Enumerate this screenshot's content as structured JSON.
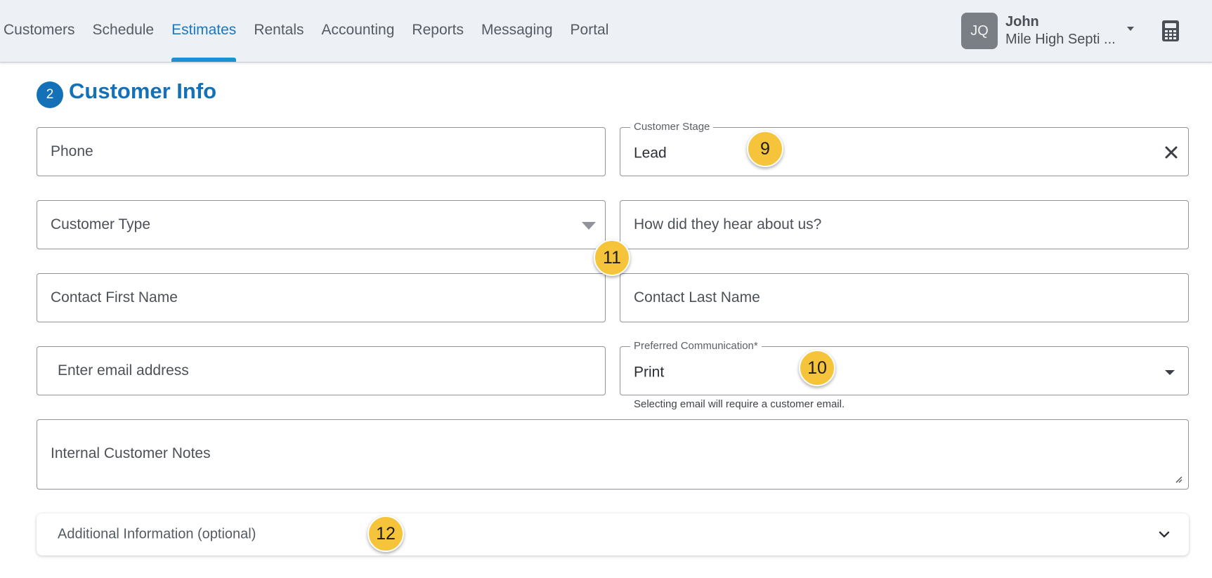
{
  "nav": {
    "items": [
      {
        "label": "Customers"
      },
      {
        "label": "Schedule"
      },
      {
        "label": "Estimates",
        "active": true
      },
      {
        "label": "Rentals"
      },
      {
        "label": "Accounting"
      },
      {
        "label": "Reports"
      },
      {
        "label": "Messaging"
      },
      {
        "label": "Portal"
      }
    ],
    "accent_color": "#1e90d6"
  },
  "user": {
    "initials": "JQ",
    "name": "John",
    "company": "Mile High Septi ..."
  },
  "icons": {
    "calculator": "calculator-icon",
    "clear": "close-icon",
    "dropdown": "caret-down-icon",
    "expand": "chevron-down-icon"
  },
  "section": {
    "step": "2",
    "title": "Customer Info",
    "title_color": "#1471b8"
  },
  "form": {
    "phone_placeholder": "Phone",
    "customer_stage_label": "Customer Stage",
    "customer_stage_value": "Lead",
    "customer_type_placeholder": "Customer Type",
    "hear_about_placeholder": "How did they hear about us?",
    "first_name_placeholder": "Contact First Name",
    "last_name_placeholder": "Contact Last Name",
    "email_placeholder": "Enter email address",
    "preferred_comm_label": "Preferred Communication*",
    "preferred_comm_value": "Print",
    "preferred_comm_helper": "Selecting email will require a customer email.",
    "notes_placeholder": "Internal Customer Notes",
    "additional_info_label": "Additional Information (optional)"
  },
  "markers": [
    "9",
    "11",
    "10",
    "12"
  ],
  "marker_color": "#f6c43a"
}
